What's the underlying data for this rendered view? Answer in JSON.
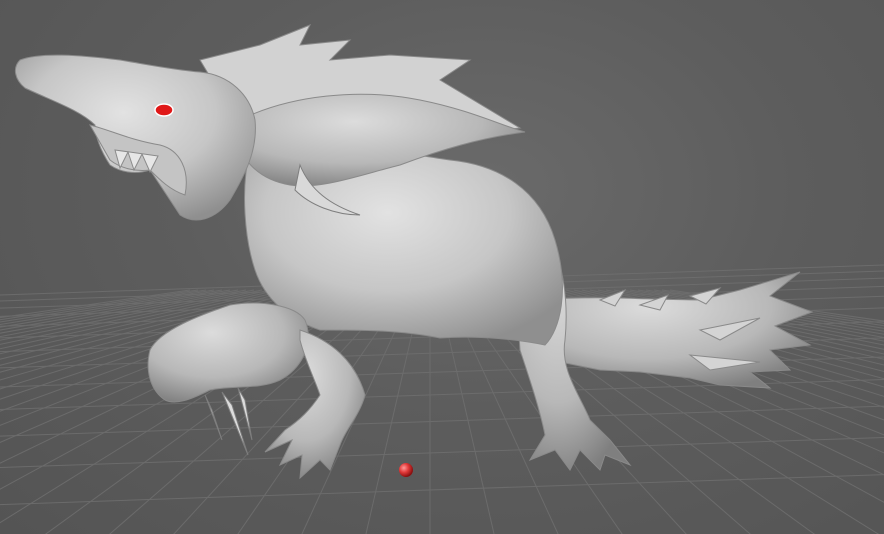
{
  "viewport": {
    "background_color": "#5e5e5e",
    "grid_line_color": "#6f6f6f",
    "model_surface_color": "#c9c9c9",
    "model_shadow_color": "#8e8e8e",
    "eye_highlight_color": "#e01818",
    "pivot_marker_color": "#e23a3a"
  },
  "scene": {
    "model_name": "",
    "grid_visible": true,
    "pivot_marker_visible": true
  }
}
